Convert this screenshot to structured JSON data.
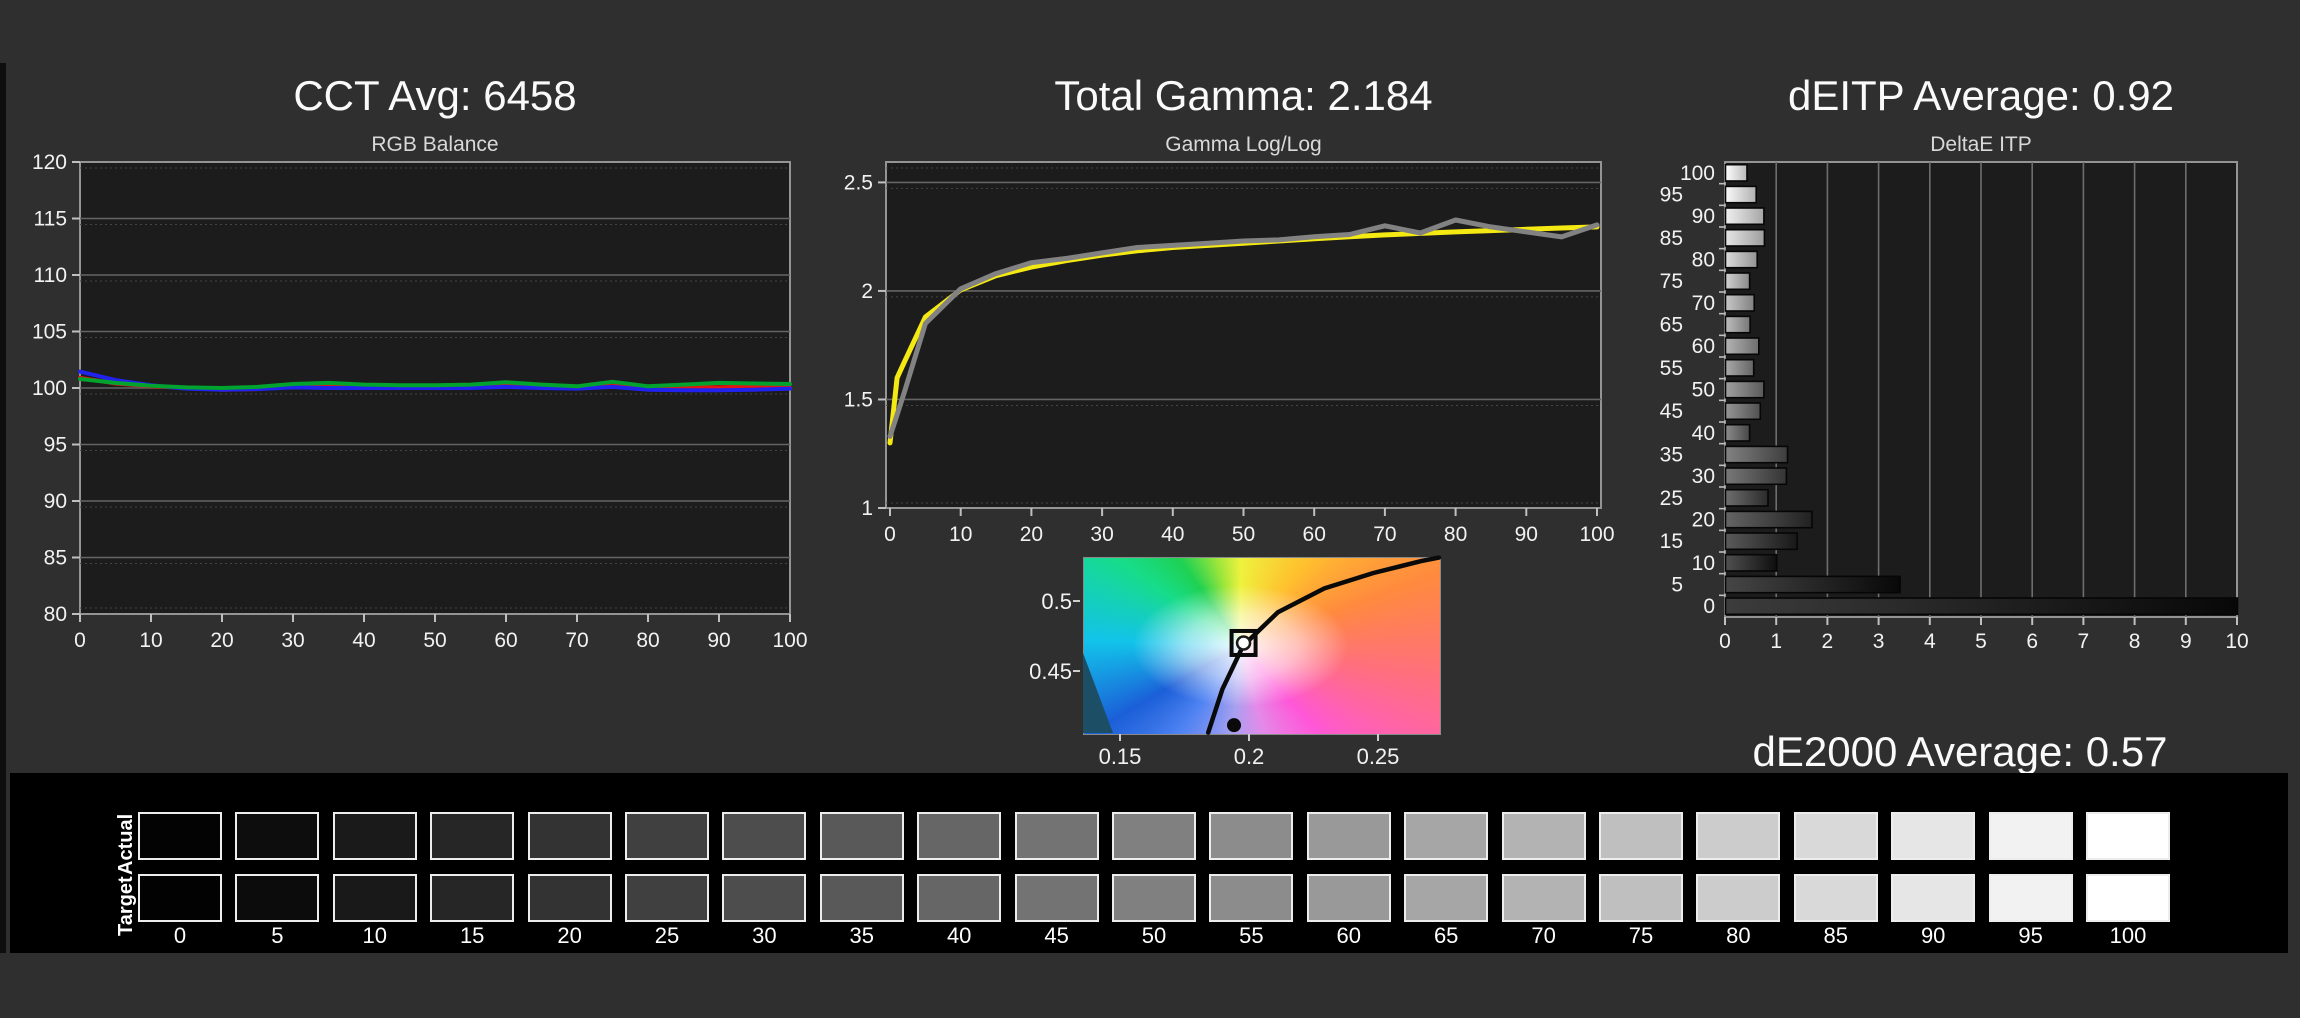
{
  "colors": {
    "background": "#2f2f2f",
    "panel": "#000000",
    "plot_bg": "#1c1c1c",
    "grid": "#646464",
    "grid_dashed": "#454545",
    "plot_border": "#949494",
    "tick_text": "#f2f2f2",
    "title_text": "#fafafa",
    "red": "#e41414",
    "green": "#00a32e",
    "blue": "#2222ee",
    "yellow": "#f5e913",
    "gray_line": "#828282",
    "locus_black": "#0a0a0a",
    "cie_triangle": "#1c4e66"
  },
  "chart_data": [
    {
      "id": "rgb_balance",
      "type": "line",
      "title": "CCT Avg: 6458",
      "subtitle": "RGB Balance",
      "xlim": [
        0,
        100
      ],
      "ylim": [
        80,
        120
      ],
      "yticks": [
        80,
        85,
        90,
        95,
        100,
        105,
        110,
        115,
        120
      ],
      "xticks": [
        0,
        10,
        20,
        30,
        40,
        50,
        60,
        70,
        80,
        90,
        100
      ],
      "x": [
        0,
        5,
        10,
        15,
        20,
        25,
        30,
        35,
        40,
        45,
        50,
        55,
        60,
        65,
        70,
        75,
        80,
        85,
        90,
        95,
        100
      ],
      "series": [
        {
          "name": "red",
          "color_key": "red",
          "values": [
            100.9,
            100.4,
            100.15,
            100.0,
            99.85,
            99.9,
            100.15,
            100.1,
            100.05,
            100.05,
            100.05,
            100.1,
            100.3,
            100.15,
            99.95,
            100.2,
            100.0,
            100.1,
            100.05,
            100.15,
            100.0
          ]
        },
        {
          "name": "blue",
          "color_key": "blue",
          "values": [
            101.45,
            100.7,
            100.25,
            99.95,
            99.85,
            99.9,
            100.05,
            100.0,
            100.0,
            100.0,
            100.0,
            100.0,
            100.1,
            100.0,
            99.95,
            100.1,
            99.85,
            99.8,
            99.8,
            99.85,
            99.95
          ]
        },
        {
          "name": "green",
          "color_key": "green",
          "values": [
            100.8,
            100.45,
            100.2,
            100.05,
            100.0,
            100.1,
            100.35,
            100.45,
            100.3,
            100.25,
            100.25,
            100.3,
            100.5,
            100.3,
            100.15,
            100.55,
            100.15,
            100.3,
            100.45,
            100.4,
            100.35
          ]
        }
      ]
    },
    {
      "id": "gamma",
      "type": "line",
      "title": "Total Gamma: 2.184",
      "subtitle": "Gamma Log/Log",
      "xlim": [
        0,
        100
      ],
      "ylim": [
        1,
        2.594
      ],
      "yticks": [
        1,
        1.5,
        2,
        2.5
      ],
      "ytick_labels": [
        "1",
        "1.5",
        "2",
        "2.5"
      ],
      "xticks": [
        0,
        10,
        20,
        30,
        40,
        50,
        60,
        70,
        80,
        90,
        100
      ],
      "x": [
        0,
        1,
        2,
        5,
        10,
        15,
        20,
        25,
        30,
        35,
        40,
        45,
        50,
        55,
        60,
        65,
        70,
        75,
        80,
        85,
        90,
        95,
        100
      ],
      "series": [
        {
          "name": "reference",
          "color_key": "yellow",
          "values": [
            1.3,
            1.6,
            1.67,
            1.88,
            2.005,
            2.07,
            2.11,
            2.14,
            2.165,
            2.185,
            2.2,
            2.21,
            2.22,
            2.23,
            2.24,
            2.25,
            2.258,
            2.265,
            2.272,
            2.278,
            2.284,
            2.29,
            2.295
          ]
        },
        {
          "name": "measured",
          "color_key": "gray_line",
          "values": [
            1.33,
            1.43,
            1.53,
            1.85,
            2.01,
            2.08,
            2.13,
            2.15,
            2.175,
            2.2,
            2.21,
            2.22,
            2.23,
            2.235,
            2.25,
            2.26,
            2.3,
            2.267,
            2.327,
            2.295,
            2.272,
            2.249,
            2.304
          ]
        }
      ]
    },
    {
      "id": "cie_detail",
      "type": "scatter",
      "title": "",
      "subtitle": "",
      "xlim": [
        0.1355,
        0.2734
      ],
      "ylim": [
        0.4057,
        0.5314
      ],
      "xticks": [
        0.15,
        0.2,
        0.25
      ],
      "xtick_labels": [
        "0.15",
        "0.2",
        "0.25"
      ],
      "yticks": [
        0.5,
        0.45
      ],
      "ytick_labels": [
        "0.5",
        "0.45"
      ],
      "locus": [
        [
          0.184,
          0.406
        ],
        [
          0.1895,
          0.437
        ],
        [
          0.1975,
          0.468
        ],
        [
          0.211,
          0.492
        ],
        [
          0.229,
          0.509
        ],
        [
          0.248,
          0.52
        ],
        [
          0.2665,
          0.5285
        ],
        [
          0.2734,
          0.531
        ]
      ],
      "white_point": {
        "u": 0.1977,
        "v": 0.47
      },
      "measured_point": {
        "u": 0.194,
        "v": 0.4113
      }
    },
    {
      "id": "deitp",
      "type": "bar",
      "title": "dEITP Average: 0.92",
      "subtitle": "DeltaE ITP",
      "footer": "dE2000 Average: 0.57",
      "xlim": [
        0,
        10
      ],
      "xticks": [
        0,
        1,
        2,
        3,
        4,
        5,
        6,
        7,
        8,
        9,
        10
      ],
      "categories": [
        100,
        95,
        90,
        85,
        80,
        75,
        70,
        65,
        60,
        55,
        50,
        45,
        40,
        35,
        30,
        25,
        20,
        15,
        10,
        5,
        0
      ],
      "values": [
        0.42,
        0.6,
        0.75,
        0.76,
        0.62,
        0.47,
        0.56,
        0.48,
        0.65,
        0.55,
        0.75,
        0.68,
        0.47,
        1.21,
        1.19,
        0.83,
        1.69,
        1.4,
        1.0,
        3.41,
        10.0
      ]
    }
  ],
  "grayscale_ramp": {
    "row_labels": [
      "Actual",
      "Target"
    ],
    "levels": [
      0,
      5,
      10,
      15,
      20,
      25,
      30,
      35,
      40,
      45,
      50,
      55,
      60,
      65,
      70,
      75,
      80,
      85,
      90,
      95,
      100
    ],
    "actual_hex": [
      "#030303",
      "#0d0d0d",
      "#1a1a1a",
      "#262626",
      "#333333",
      "#404040",
      "#4d4d4d",
      "#595959",
      "#666666",
      "#737373",
      "#808080",
      "#8c8c8c",
      "#999999",
      "#a6a6a6",
      "#b3b3b3",
      "#bfbfbf",
      "#cccccc",
      "#d9d9d9",
      "#e6e6e6",
      "#f2f2f2",
      "#ffffff"
    ],
    "target_hex": [
      "#020202",
      "#0c0c0c",
      "#191919",
      "#262626",
      "#333333",
      "#404040",
      "#4d4d4d",
      "#595959",
      "#666666",
      "#737373",
      "#808080",
      "#8c8c8c",
      "#999999",
      "#a6a6a6",
      "#b3b3b3",
      "#bfbfbf",
      "#cccccc",
      "#d9d9d9",
      "#e6e6e6",
      "#f2f2f2",
      "#ffffff"
    ]
  }
}
